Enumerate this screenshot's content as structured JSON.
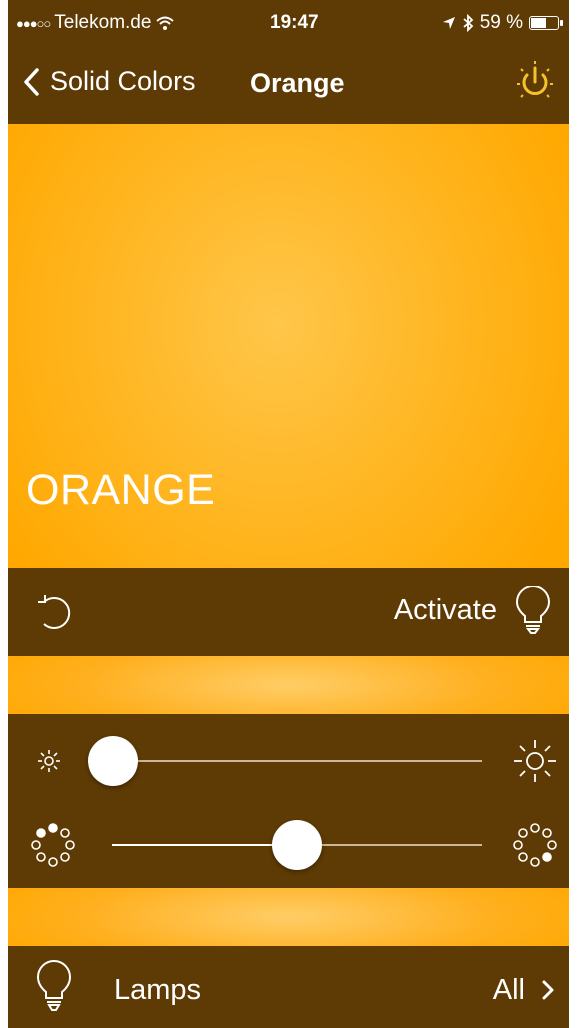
{
  "status_bar": {
    "signal_dots": "●●●○○",
    "carrier": "Telekom.de",
    "time": "19:47",
    "battery_percent": "59 %",
    "battery_level": 0.59
  },
  "nav": {
    "back_label": "Solid Colors",
    "title": "Orange",
    "power_icon": "power-icon"
  },
  "preview": {
    "color_name": "ORANGE",
    "color": "#ffb000"
  },
  "action_bar": {
    "undo_icon": "undo-icon",
    "activate_label": "Activate",
    "bulb_icon": "lightbulb-icon"
  },
  "sliders": {
    "brightness": {
      "value": 0,
      "min_icon": "sun-small-icon",
      "max_icon": "sun-large-icon"
    },
    "saturation": {
      "value": 0.5,
      "min_icon": "dial-low-icon",
      "max_icon": "dial-high-icon"
    }
  },
  "lamps": {
    "label": "Lamps",
    "value": "All",
    "icon": "lightbulb-icon"
  },
  "colors": {
    "bar_brown": "#5e3a05",
    "orange": "#ffa800",
    "power_yellow": "#f4c32a"
  }
}
